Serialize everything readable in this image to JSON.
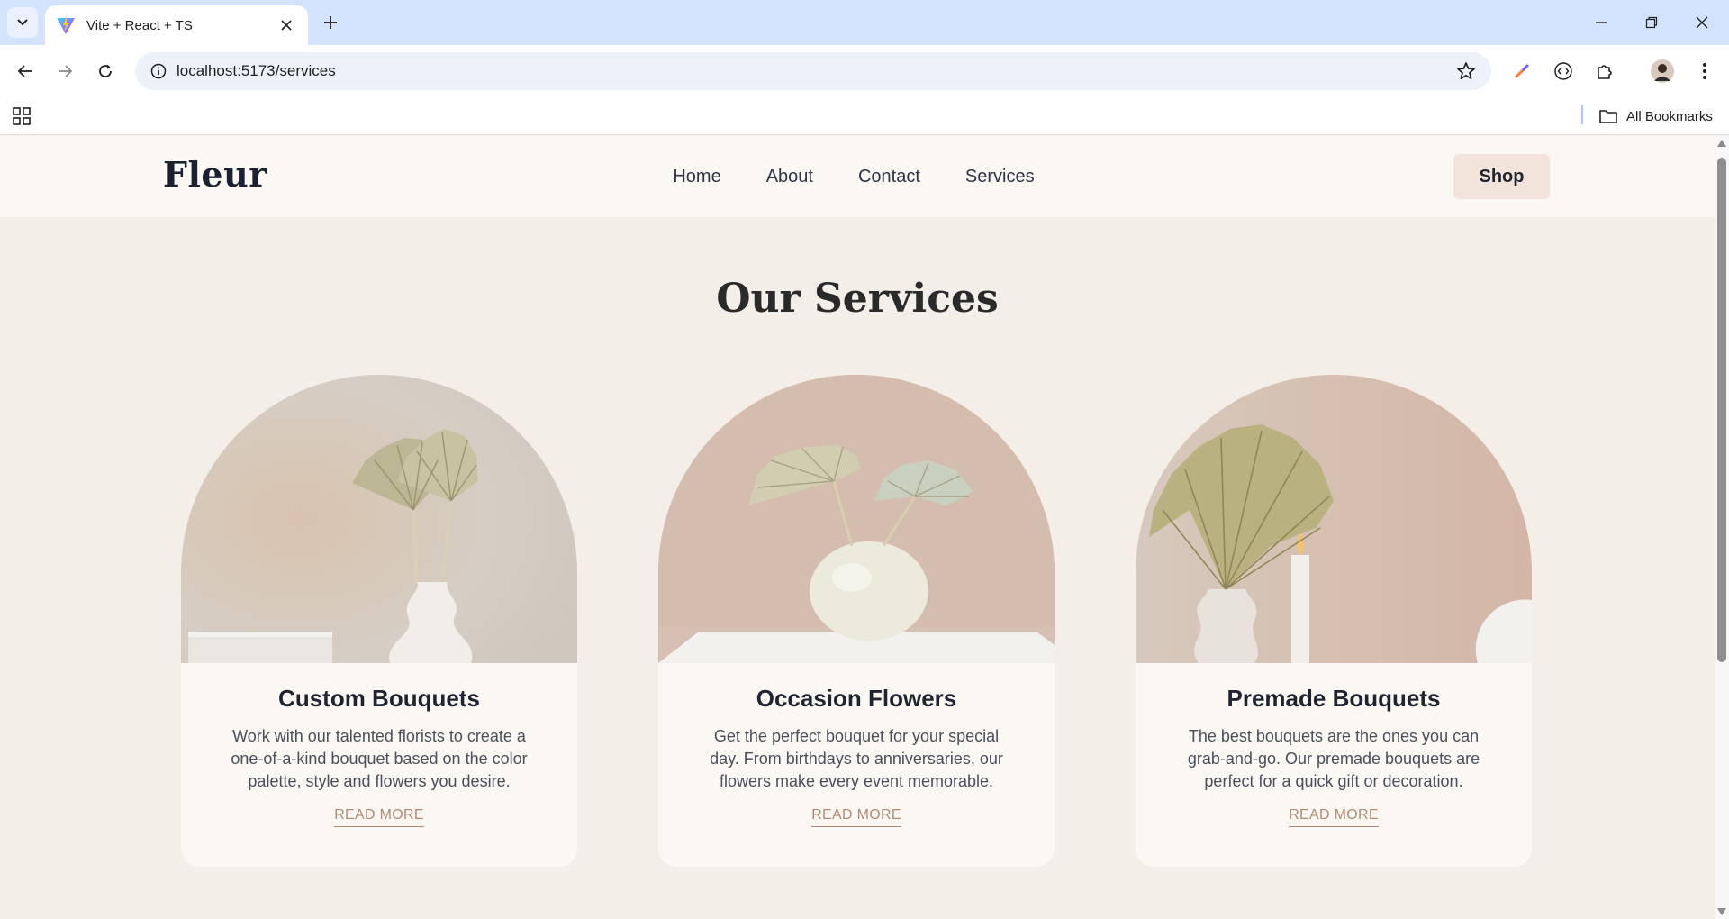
{
  "browser": {
    "tab_title": "Vite + React + TS",
    "url": "localhost:5173/services",
    "bookmarks_label": "All Bookmarks"
  },
  "site": {
    "logo": "Fleur",
    "nav": [
      "Home",
      "About",
      "Contact",
      "Services"
    ],
    "shop_label": "Shop"
  },
  "main": {
    "title": "Our Services",
    "cards": [
      {
        "title": "Custom Bouquets",
        "text": "Work with our talented florists to create a one-of-a-kind bouquet based on the color palette, style and flowers you desire.",
        "link": "READ MORE"
      },
      {
        "title": "Occasion Flowers",
        "text": "Get the perfect bouquet for your special day. From birthdays to anniversaries, our flowers make every event memorable.",
        "link": "READ MORE"
      },
      {
        "title": "Premade Bouquets",
        "text": "The best bouquets are the ones you can grab-and-go. Our premade bouquets are perfect for a quick gift or decoration.",
        "link": "READ MORE"
      }
    ]
  },
  "colors": {
    "page_bg": "#f3eee8",
    "header_bg": "#fbf8f4",
    "shop_bg": "#f2e4db",
    "link_accent": "#b08a74",
    "chrome_tabstrip": "#d3e3fd"
  }
}
